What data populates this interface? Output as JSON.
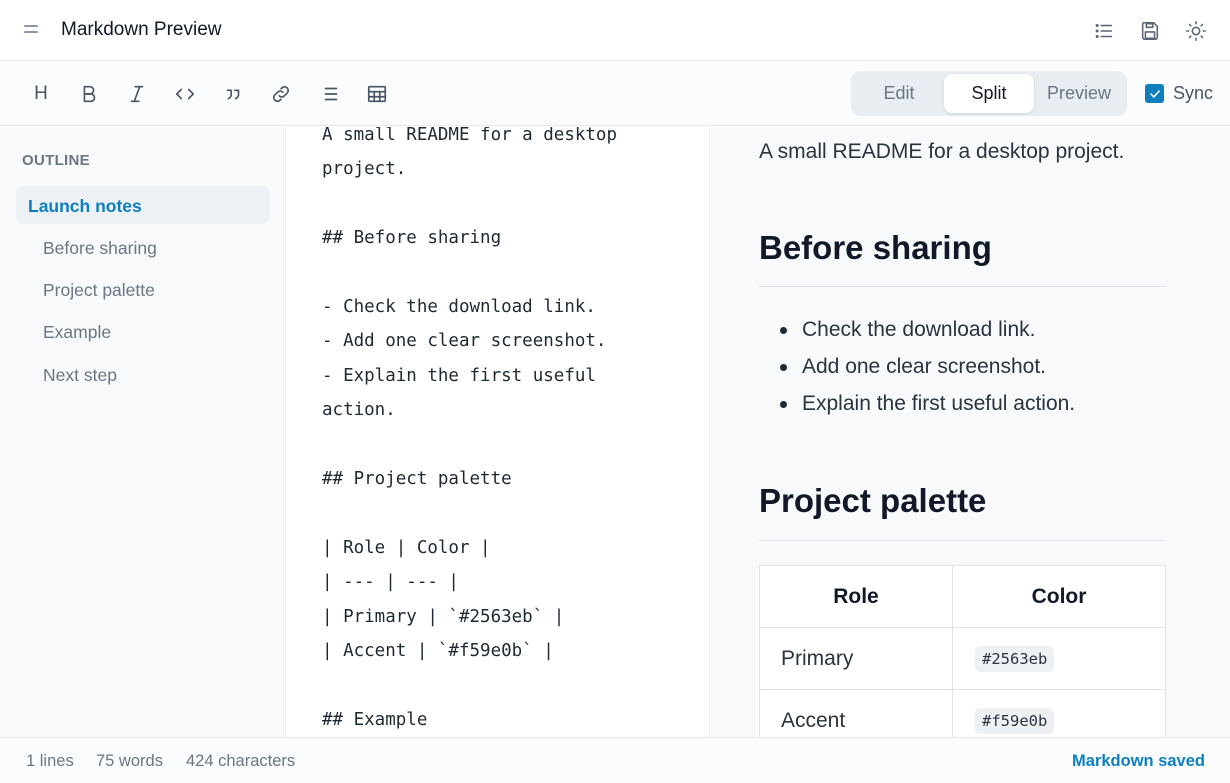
{
  "app": {
    "title": "Markdown Preview"
  },
  "toolbar": {
    "tools": [
      "heading",
      "bold",
      "italic",
      "code",
      "quote",
      "link",
      "list",
      "table"
    ],
    "heading_label": "H",
    "modes": [
      "Edit",
      "Split",
      "Preview"
    ],
    "active_mode": "Split",
    "sync_label": "Sync",
    "sync_checked": true
  },
  "sidebar": {
    "heading": "OUTLINE",
    "items": [
      {
        "label": "Launch notes",
        "active": true
      },
      {
        "label": "Before sharing"
      },
      {
        "label": "Project palette"
      },
      {
        "label": "Example"
      },
      {
        "label": "Next step"
      }
    ]
  },
  "editor": {
    "lines": [
      "A small README for a desktop",
      "project.",
      "",
      "## Before sharing",
      "",
      "- Check the download link.",
      "- Add one clear screenshot.",
      "- Explain the first useful",
      "action.",
      "",
      "## Project palette",
      "",
      "| Role | Color |",
      "| --- | --- |",
      "| Primary | `#2563eb` |",
      "| Accent | `#f59e0b` |",
      "",
      "## Example"
    ]
  },
  "preview": {
    "intro": "A small README for a desktop project.",
    "h_before": "Before sharing",
    "list": [
      "Check the download link.",
      "Add one clear screenshot.",
      "Explain the first useful action."
    ],
    "h_palette": "Project palette",
    "table": {
      "headers": [
        "Role",
        "Color"
      ],
      "rows": [
        [
          "Primary",
          "#2563eb"
        ],
        [
          "Accent",
          "#f59e0b"
        ]
      ]
    }
  },
  "status": {
    "lines": "1 lines",
    "words": "75 words",
    "chars": "424 characters",
    "saved": "Markdown saved"
  },
  "colors": {
    "accent": "#0d7fbe",
    "sidebar_bg": "#f7f9fb"
  }
}
